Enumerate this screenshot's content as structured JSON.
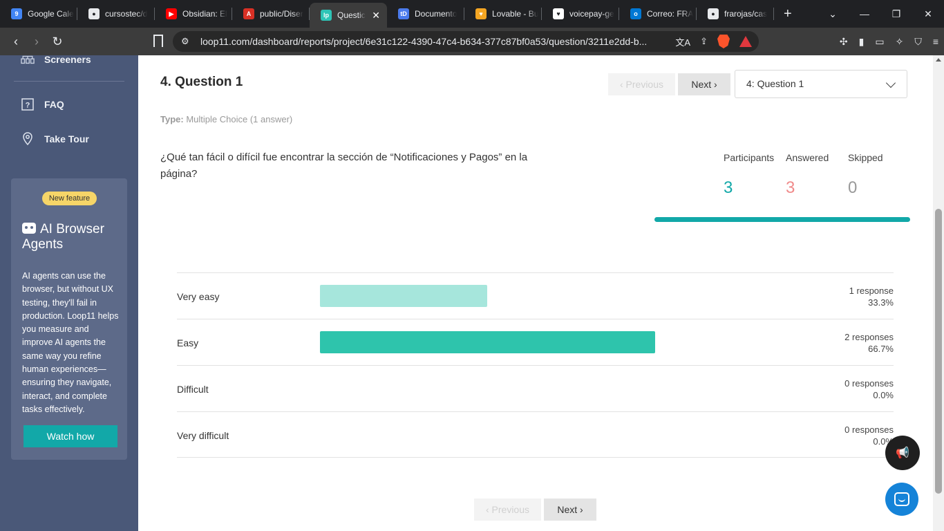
{
  "browser": {
    "tabs": [
      {
        "title": "Google Cale",
        "icon": "google-calendar-icon",
        "color": "#4285f4",
        "glyph": "9"
      },
      {
        "title": "cursostec/d",
        "icon": "github-icon",
        "color": "#e8eaed",
        "glyph": "●"
      },
      {
        "title": "Obsidian: El",
        "icon": "youtube-icon",
        "color": "#ff0000",
        "glyph": "▶"
      },
      {
        "title": "public/Diser",
        "icon": "pdf-icon",
        "color": "#d93025",
        "glyph": "A"
      },
      {
        "title": "Questic",
        "icon": "loop11-icon",
        "color": "#2ec4b6",
        "glyph": "lp",
        "active": true
      },
      {
        "title": "Documento",
        "icon": "td-icon",
        "color": "#4b7bec",
        "glyph": "tD"
      },
      {
        "title": "Lovable - Bu",
        "icon": "lovable-icon",
        "color": "#f5a623",
        "glyph": "♥"
      },
      {
        "title": "voicepay-ge",
        "icon": "heart-icon",
        "color": "#ffffff",
        "glyph": "♥"
      },
      {
        "title": "Correo: FRA",
        "icon": "outlook-icon",
        "color": "#0078d4",
        "glyph": "o"
      },
      {
        "title": "frarojas/cas",
        "icon": "github-icon",
        "color": "#e8eaed",
        "glyph": "●"
      }
    ],
    "url": "loop11.com/dashboard/reports/project/6e31c122-4390-47c4-b634-377c87bf0a53/question/3211e2dd-b...",
    "brave_badge": "6"
  },
  "sidebar": {
    "items": [
      {
        "label": "Screeners",
        "icon": "screeners-icon"
      },
      {
        "label": "FAQ",
        "icon": "question-icon"
      },
      {
        "label": "Take Tour",
        "icon": "location-pin-icon"
      }
    ],
    "promo": {
      "badge": "New feature",
      "title": "AI Browser Agents",
      "body": "AI agents can use the browser, but without UX testing, they'll fail in production. Loop11 helps you measure and improve AI agents the same way you refine human experiences—ensuring they navigate, interact, and complete tasks effectively.",
      "button": "Watch how"
    }
  },
  "main": {
    "title": "4. Question 1",
    "prev_label": "‹ Previous",
    "next_label": "Next ›",
    "select_value": "4: Question 1",
    "type_label": "Type:",
    "type_value": "Multiple Choice (1 answer)",
    "question": "¿Qué tan fácil o difícil fue encontrar la sección de “Notificaciones y Pagos” en la página?",
    "stats": [
      {
        "label": "Participants",
        "value": "3",
        "color": "#12a8a8"
      },
      {
        "label": "Answered",
        "value": "3",
        "color": "#f08a8a"
      },
      {
        "label": "Skipped",
        "value": "0",
        "color": "#999999"
      }
    ],
    "answered_fraction": 1.0,
    "results": [
      {
        "label": "Very easy",
        "responses": "1 response",
        "percent": "33.3%",
        "fraction": 0.333,
        "color": "#a6e6dc"
      },
      {
        "label": "Easy",
        "responses": "2 responses",
        "percent": "66.7%",
        "fraction": 0.667,
        "color": "#2ec4ac"
      },
      {
        "label": "Difficult",
        "responses": "0 responses",
        "percent": "0.0%",
        "fraction": 0,
        "color": "#2ec4ac"
      },
      {
        "label": "Very difficult",
        "responses": "0 responses",
        "percent": "0.0%",
        "fraction": 0,
        "color": "#2ec4ac"
      }
    ]
  }
}
